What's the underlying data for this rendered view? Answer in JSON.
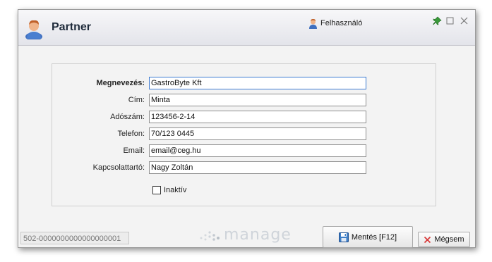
{
  "window": {
    "title": "Partner",
    "user": "Felhasználó"
  },
  "form": {
    "fields": [
      {
        "label": "Megnevezés:",
        "value": "GastroByte Kft"
      },
      {
        "label": "Cím:",
        "value": "Minta"
      },
      {
        "label": "Adószám:",
        "value": "123456-2-14"
      },
      {
        "label": "Telefon:",
        "value": "70/123 0445"
      },
      {
        "label": "Email:",
        "value": "email@ceg.hu"
      },
      {
        "label": "Kapcsolattartó:",
        "value": "Nagy Zoltán"
      }
    ],
    "inactive_label": "Inaktív",
    "inactive_checked": false
  },
  "footer": {
    "record_id": "502-0000000000000000001",
    "logo_text": "manage",
    "save_label": "Mentés [F12]",
    "cancel_label": "Mégsem"
  },
  "icons": {
    "title_icon": "user-avatar-icon",
    "user_icon": "user-avatar-icon",
    "pin_icon": "pin-icon",
    "maximize_icon": "maximize-icon",
    "close_icon": "close-icon",
    "save_icon": "floppy-disk-icon",
    "cancel_icon": "red-x-icon"
  },
  "colors": {
    "focus_border": "#3d7bd1",
    "cancel_x": "#d93a3a",
    "save_icon": "#3f7fc7",
    "pin": "#3a9a3a"
  }
}
